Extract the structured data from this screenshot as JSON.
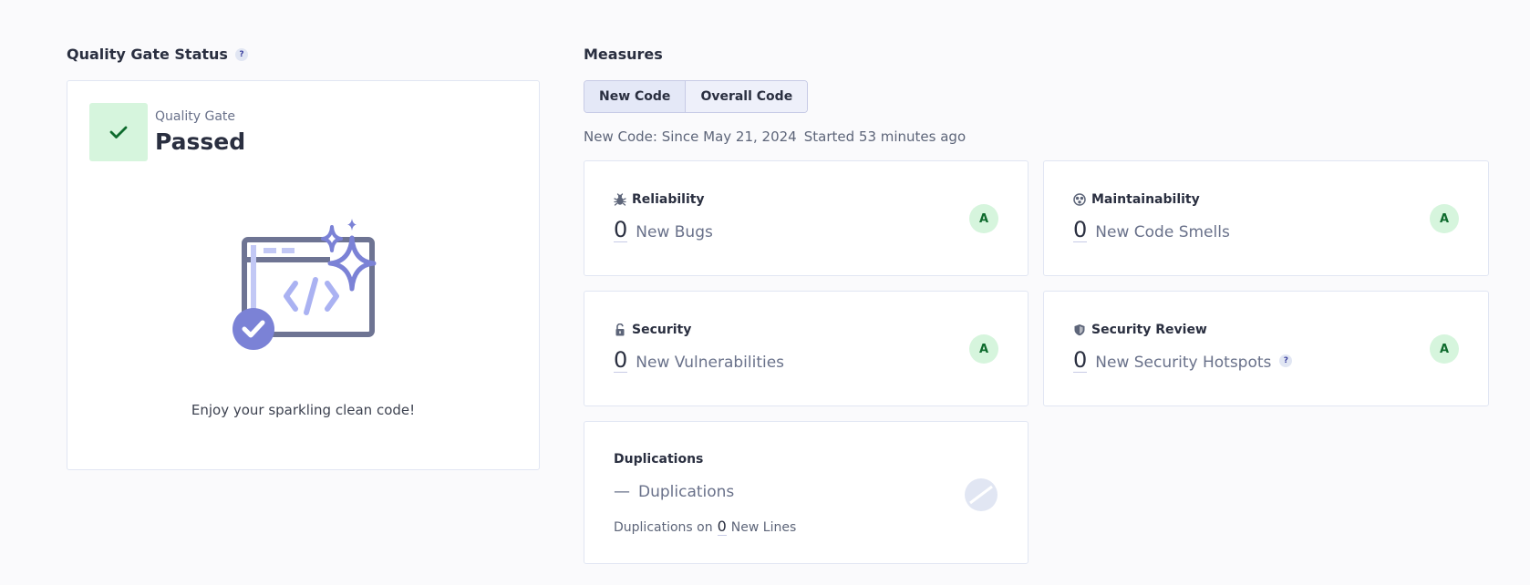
{
  "quality_gate": {
    "section_title": "Quality Gate Status",
    "help": "?",
    "label": "Quality Gate",
    "status": "Passed",
    "message": "Enjoy your sparkling clean code!",
    "status_color": "#d6f5dd"
  },
  "measures": {
    "section_title": "Measures",
    "tabs": [
      {
        "label": "New Code",
        "active": true
      },
      {
        "label": "Overall Code",
        "active": false
      }
    ],
    "new_code_since": "New Code: Since May 21, 2024",
    "started": "Started 53 minutes ago",
    "cards": {
      "reliability": {
        "title": "Reliability",
        "value": "0",
        "label": "New Bugs",
        "rating": "A",
        "icon": "bug-icon"
      },
      "maintainability": {
        "title": "Maintainability",
        "value": "0",
        "label": "New Code Smells",
        "rating": "A",
        "icon": "smell-icon"
      },
      "security": {
        "title": "Security",
        "value": "0",
        "label": "New Vulnerabilities",
        "rating": "A",
        "icon": "unlock-icon"
      },
      "security_review": {
        "title": "Security Review",
        "value": "0",
        "label": "New Security Hotspots",
        "help": "?",
        "rating": "A",
        "icon": "shield-icon"
      },
      "duplications": {
        "title": "Duplications",
        "value": "—",
        "label": "Duplications",
        "sub_prefix": "Duplications on",
        "sub_value": "0",
        "sub_suffix": "New Lines",
        "icon": "no-data-icon"
      }
    },
    "rating_color": "#d6f5dd"
  }
}
